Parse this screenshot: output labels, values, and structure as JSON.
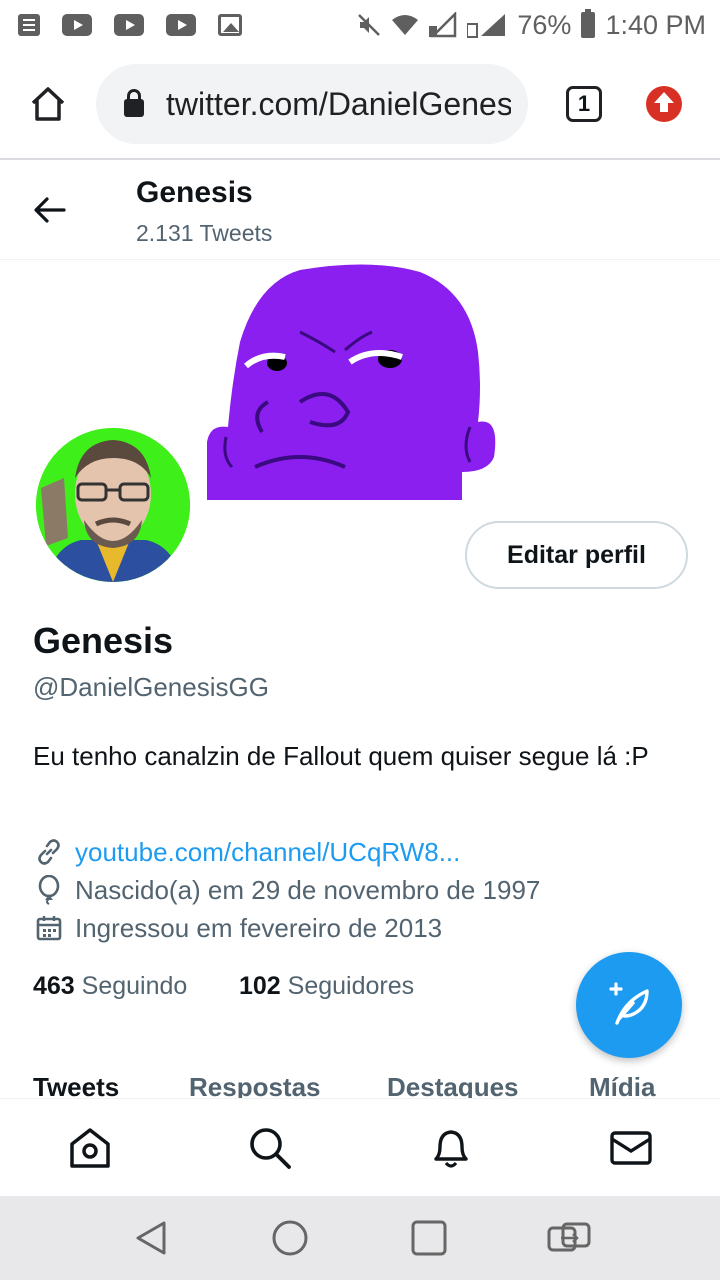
{
  "status_bar": {
    "battery": "76%",
    "time": "1:40 PM"
  },
  "browser": {
    "url": "twitter.com/DanielGenes",
    "tab_count": "1"
  },
  "header": {
    "name": "Genesis",
    "tweet_count": "2.131 Tweets"
  },
  "profile": {
    "edit_button": "Editar perfil",
    "name": "Genesis",
    "handle": "@DanielGenesisGG",
    "bio": "Eu tenho canalzin de Fallout quem quiser segue lá :P",
    "link": "youtube.com/channel/UCqRW8...",
    "birth": "Nascido(a) em 29 de novembro de 1997",
    "joined": "Ingressou em fevereiro de 2013",
    "following_count": "463",
    "following_label": "Seguindo",
    "followers_count": "102",
    "followers_label": "Seguidores"
  },
  "tabs": [
    "Tweets",
    "Respostas",
    "Destaques",
    "Mídia"
  ],
  "colors": {
    "accent": "#1d9bf0",
    "banner_character": "#8a1fef",
    "avatar_background": "#3fef1a"
  }
}
